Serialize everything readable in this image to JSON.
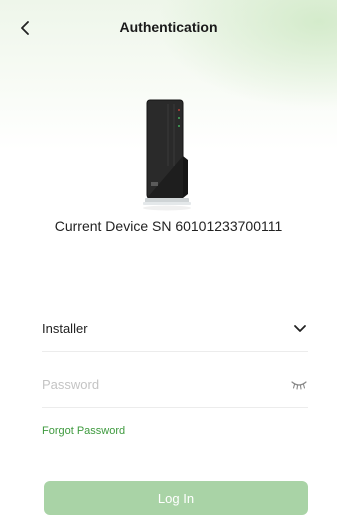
{
  "header": {
    "title": "Authentication",
    "back_icon": "chevron-left-icon"
  },
  "device": {
    "image": "inverter-device-image",
    "sn_text": "Current Device SN 60101233700111"
  },
  "form": {
    "role_value": "Installer",
    "role_icon": "chevron-down-icon",
    "password_value": "",
    "password_placeholder": "Password",
    "visibility_icon": "eye-closed-icon",
    "forgot_password": "Forgot Password",
    "login_label": "Log In"
  },
  "colors": {
    "accent_green": "#3e9a3e",
    "button_disabled_green": "#a9d3a6",
    "header_tint": "#eef6ea"
  }
}
